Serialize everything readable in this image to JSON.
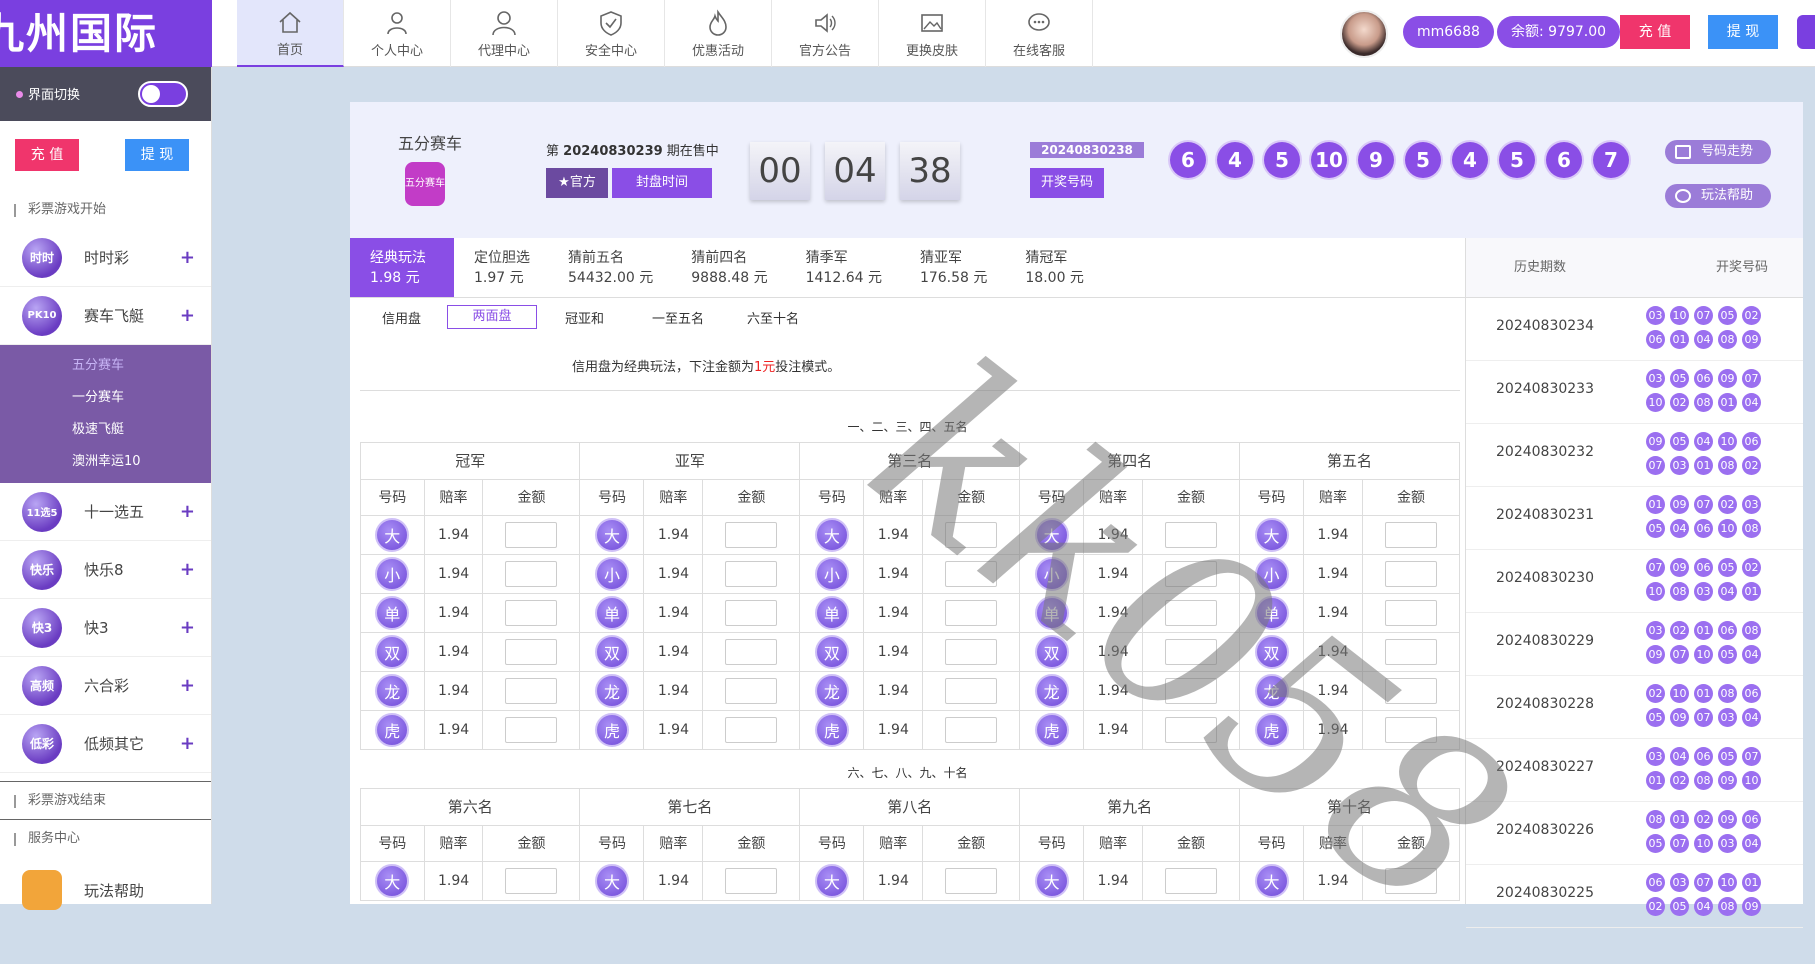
{
  "logo": {
    "text": "九州国际"
  },
  "nav": [
    {
      "label": "首页",
      "icon": "home-icon"
    },
    {
      "label": "个人中心",
      "icon": "user-icon"
    },
    {
      "label": "代理中心",
      "icon": "agent-icon"
    },
    {
      "label": "安全中心",
      "icon": "shield-icon"
    },
    {
      "label": "优惠活动",
      "icon": "flame-icon"
    },
    {
      "label": "官方公告",
      "icon": "speaker-icon"
    },
    {
      "label": "更换皮肤",
      "icon": "image-icon"
    },
    {
      "label": "在线客服",
      "icon": "chat-icon"
    }
  ],
  "user": {
    "name": "mm6688",
    "balance": "余额: 9797.00",
    "recharge": "充 值",
    "withdraw": "提 现"
  },
  "sidebar": {
    "switch_label": "界面切换",
    "recharge": "充 值",
    "withdraw": "提 现",
    "start_label": "彩票游戏开始",
    "end_label": "彩票游戏结束",
    "service_label": "服务中心",
    "help_label": "玩法帮助",
    "games": [
      {
        "name": "时时彩",
        "icon_text": "时时"
      },
      {
        "name": "赛车飞艇",
        "icon_text": "PK10"
      }
    ],
    "subgames": [
      "五分赛车",
      "一分赛车",
      "极速飞艇",
      "澳洲幸运10"
    ],
    "games2": [
      {
        "name": "十一选五",
        "icon_text": "11选5"
      },
      {
        "name": "快乐8",
        "icon_text": "快乐"
      },
      {
        "name": "快3",
        "icon_text": "快3"
      },
      {
        "name": "六合彩",
        "icon_text": "高频"
      },
      {
        "name": "低频其它",
        "icon_text": "低彩"
      }
    ]
  },
  "lottery": {
    "name": "五分赛车",
    "icon_text": "五分赛车",
    "period_prefix": "第",
    "period": "20240830239",
    "period_suffix": "期在售中",
    "official": "★官方",
    "close_time": "封盘时间",
    "timer": [
      "00",
      "04",
      "38"
    ],
    "last_period": "20240830238",
    "draw_label": "开奖号码",
    "balls": [
      "6",
      "4",
      "5",
      "10",
      "9",
      "5",
      "4",
      "5",
      "6",
      "7"
    ],
    "trend_btn": "号码走势",
    "help_btn": "玩法帮助"
  },
  "play_tabs": [
    {
      "name": "经典玩法",
      "odds": "1.98 元"
    },
    {
      "name": "定位胆选",
      "odds": "1.97 元"
    },
    {
      "name": "猜前五名",
      "odds": "54432.00 元"
    },
    {
      "name": "猜前四名",
      "odds": "9888.48 元"
    },
    {
      "name": "猜季军",
      "odds": "1412.64 元"
    },
    {
      "name": "猜亚军",
      "odds": "176.58 元"
    },
    {
      "name": "猜冠军",
      "odds": "18.00 元"
    }
  ],
  "sub_tabs": {
    "credit": "信用盘",
    "items": [
      "两面盘",
      "冠亚和",
      "一至五名",
      "六至十名"
    ]
  },
  "note": {
    "pre": "信用盘为经典玩法，下注金额为",
    "red": "1元",
    "post": "投注模式。"
  },
  "group1_label": "一、二、三、四、五名",
  "group2_label": "六、七、八、九、十名",
  "positions1": [
    "冠军",
    "亚军",
    "第三名",
    "第四名",
    "第五名"
  ],
  "positions2": [
    "第六名",
    "第七名",
    "第八名",
    "第九名",
    "第十名"
  ],
  "col_headers": [
    "号码",
    "赔率",
    "金额"
  ],
  "bet_items": [
    "大",
    "小",
    "单",
    "双",
    "龙",
    "虎"
  ],
  "odds": "1.94",
  "history": {
    "col_period": "历史期数",
    "col_nums": "开奖号码",
    "rows": [
      {
        "period": "20240830234",
        "nums": [
          "03",
          "10",
          "07",
          "05",
          "02",
          "06",
          "01",
          "04",
          "08",
          "09"
        ]
      },
      {
        "period": "20240830233",
        "nums": [
          "03",
          "05",
          "06",
          "09",
          "07",
          "10",
          "02",
          "08",
          "01",
          "04"
        ]
      },
      {
        "period": "20240830232",
        "nums": [
          "09",
          "05",
          "04",
          "10",
          "06",
          "07",
          "03",
          "01",
          "08",
          "02"
        ]
      },
      {
        "period": "20240830231",
        "nums": [
          "01",
          "09",
          "07",
          "02",
          "03",
          "05",
          "04",
          "06",
          "10",
          "08"
        ]
      },
      {
        "period": "20240830230",
        "nums": [
          "07",
          "09",
          "06",
          "05",
          "02",
          "10",
          "08",
          "03",
          "04",
          "01"
        ]
      },
      {
        "period": "20240830229",
        "nums": [
          "03",
          "02",
          "01",
          "06",
          "08",
          "09",
          "07",
          "10",
          "05",
          "04"
        ]
      },
      {
        "period": "20240830228",
        "nums": [
          "02",
          "10",
          "01",
          "08",
          "06",
          "05",
          "09",
          "07",
          "03",
          "04"
        ]
      },
      {
        "period": "20240830227",
        "nums": [
          "03",
          "04",
          "06",
          "05",
          "07",
          "01",
          "02",
          "08",
          "09",
          "10"
        ]
      },
      {
        "period": "20240830226",
        "nums": [
          "08",
          "01",
          "02",
          "09",
          "06",
          "05",
          "07",
          "10",
          "03",
          "04"
        ]
      },
      {
        "period": "20240830225",
        "nums": [
          "06",
          "03",
          "07",
          "10",
          "01",
          "02",
          "05",
          "04",
          "08",
          "09"
        ]
      }
    ]
  },
  "watermark": "kk058"
}
